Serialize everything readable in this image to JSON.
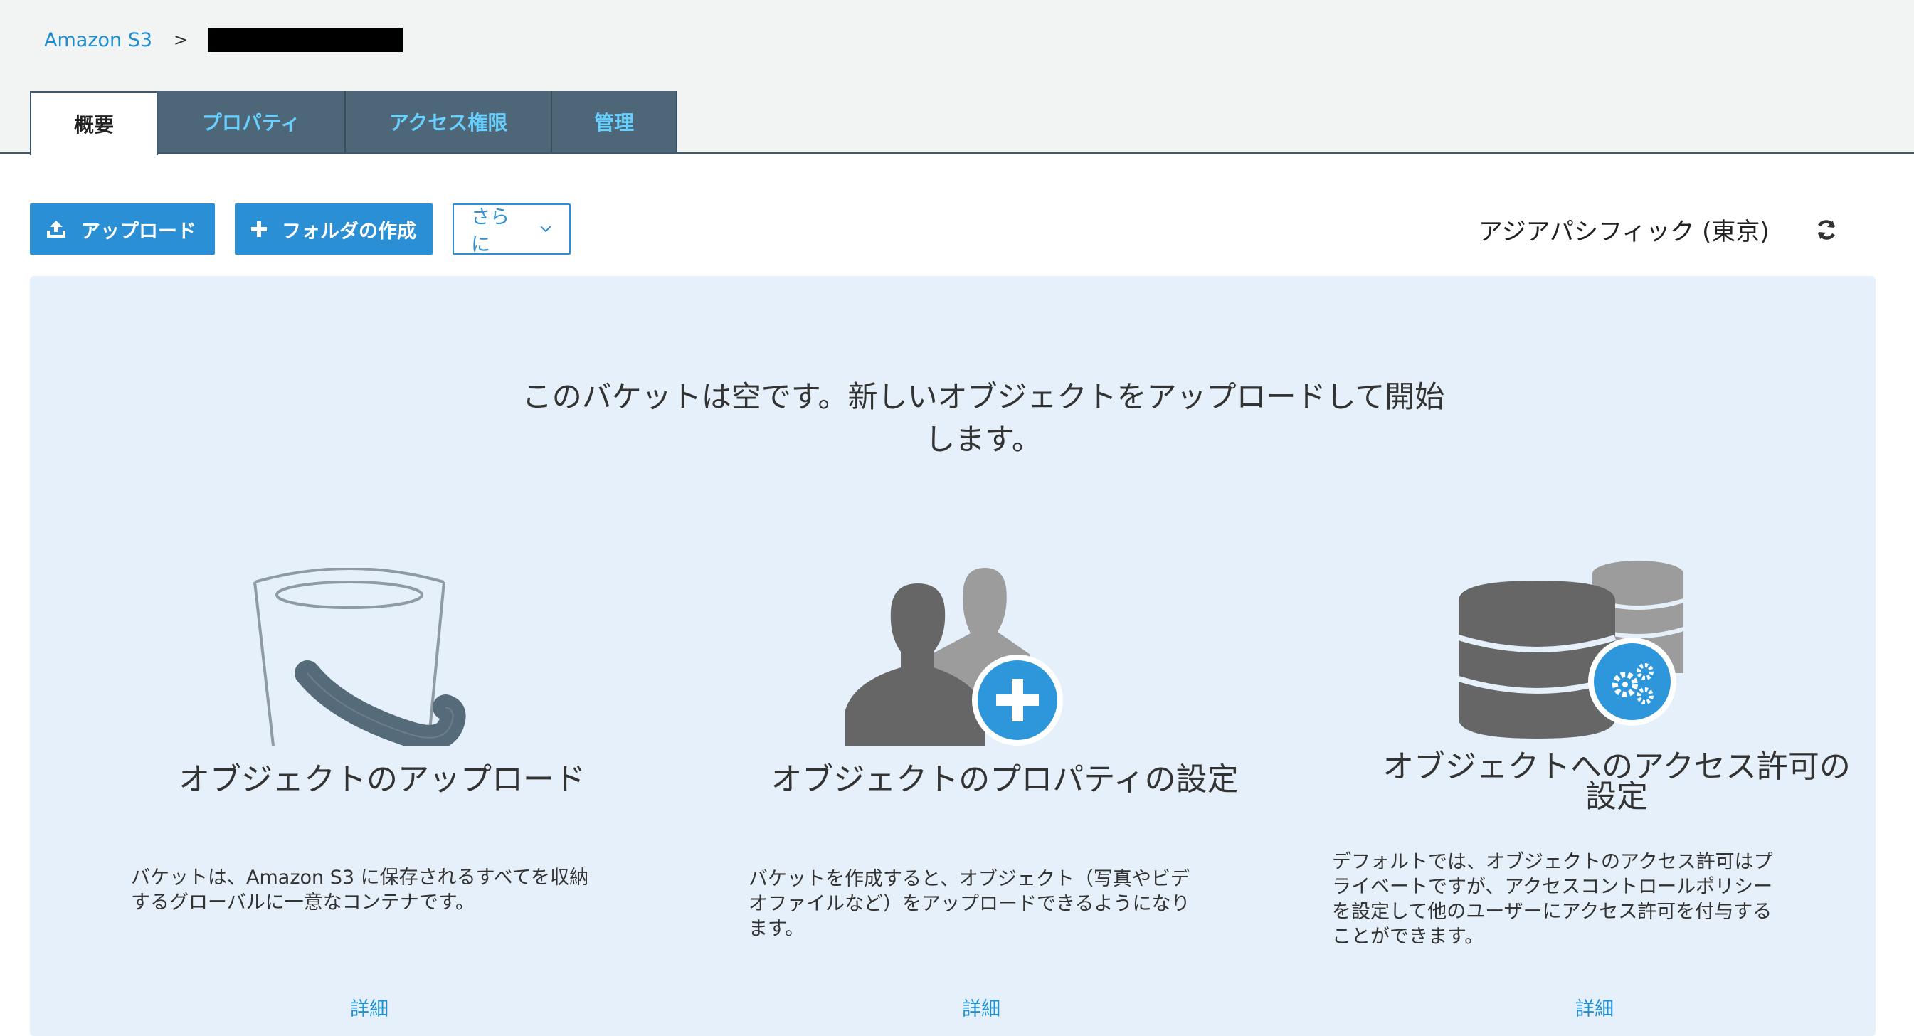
{
  "breadcrumb": {
    "root": "Amazon S3",
    "separator": ">"
  },
  "tabs": [
    {
      "label": "概要",
      "active": true
    },
    {
      "label": "プロパティ",
      "active": false
    },
    {
      "label": "アクセス権限",
      "active": false
    },
    {
      "label": "管理",
      "active": false
    }
  ],
  "toolbar": {
    "upload_label": "アップロード",
    "create_folder_label": "フォルダの作成",
    "more_label": "さらに"
  },
  "region": "アジアパシフィック (東京)",
  "empty": {
    "headline_line1": "このバケットは空です。新しいオブジェクトをアップロードして開始",
    "headline_line2": "します。"
  },
  "cards": [
    {
      "title": "オブジェクトのアップロード",
      "desc_line1": "バケットは、Amazon S3 に保存されるすべてを収納",
      "desc_line2": "するグローバルに一意なコンテナです。",
      "link": "詳細"
    },
    {
      "title": "オブジェクトのプロパティの設定",
      "desc_line1": "バケットを作成すると、オブジェクト（写真やビデ",
      "desc_line2": "オファイルなど）をアップロードできるようになり",
      "desc_line3": "ます。",
      "link": "詳細"
    },
    {
      "title_line1": "オブジェクトへのアクセス許可の",
      "title_line2": "設定",
      "desc_line1": "デフォルトでは、オブジェクトのアクセス許可はプ",
      "desc_line2": "ライベートですが、アクセスコントロールポリシー",
      "desc_line3": "を設定して他のユーザーにアクセス許可を付与する",
      "desc_line4": "ことができます。",
      "link": "詳細"
    }
  ],
  "colors": {
    "accent": "#2b8fd6",
    "link": "#1f8ecf",
    "tab_bg": "#4d6778",
    "tab_text": "#68d0ff",
    "panel_bg": "#e6f0fa",
    "icon_gray": "#666666"
  },
  "icons": [
    "upload-icon",
    "plus-icon",
    "chevron-down-icon",
    "refresh-icon",
    "bucket-illustration",
    "users-plus-illustration",
    "database-gear-illustration"
  ]
}
